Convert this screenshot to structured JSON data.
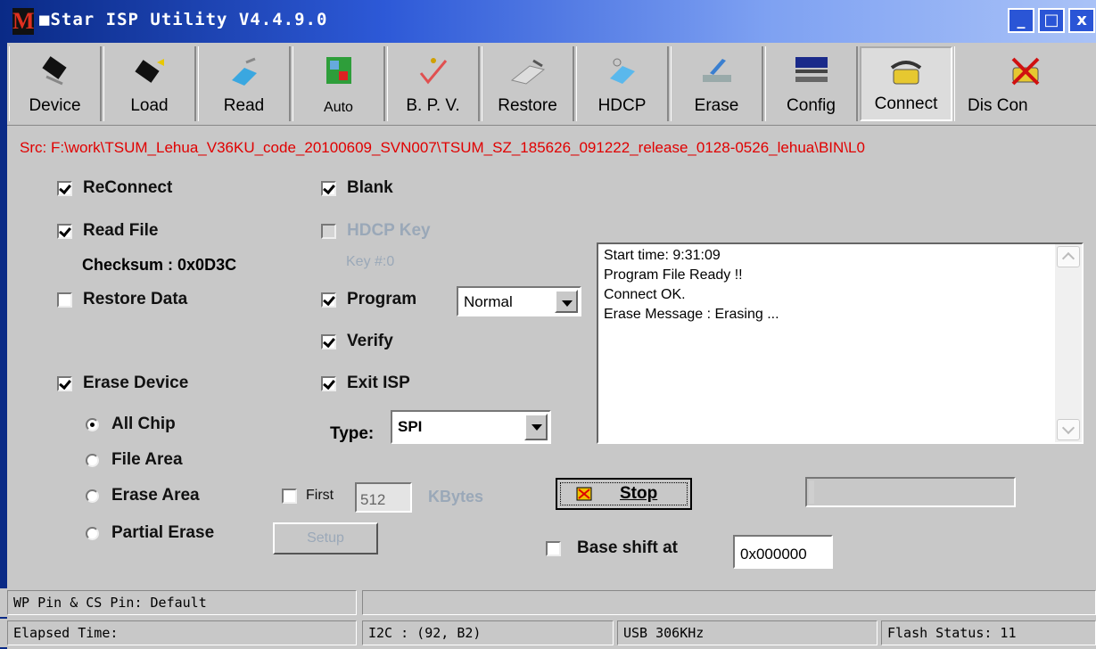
{
  "window": {
    "title": "■Star ISP Utility V4.4.9.0",
    "logo_letter": "M",
    "controls": {
      "minimize": "_",
      "maximize": "□",
      "close": "x"
    }
  },
  "toolbar": [
    {
      "label": "Device",
      "icon": "chip-icon"
    },
    {
      "label": "Load",
      "icon": "chip-load-icon"
    },
    {
      "label": "Read",
      "icon": "read-icon"
    },
    {
      "label": "Auto",
      "icon": "auto-icon"
    },
    {
      "label": "B. P. V.",
      "icon": "check-icon"
    },
    {
      "label": "Restore",
      "icon": "restore-icon"
    },
    {
      "label": "HDCP",
      "icon": "hdcp-icon"
    },
    {
      "label": "Erase",
      "icon": "erase-icon"
    },
    {
      "label": "Config",
      "icon": "config-icon"
    },
    {
      "label": "Connect",
      "icon": "phone-icon"
    },
    {
      "label": "Dis Con",
      "icon": "disconnect-icon"
    }
  ],
  "src_path": "Src: F:\\work\\TSUM_Lehua_V36KU_code_20100609_SVN007\\TSUM_SZ_185626_091222_release_0128-0526_lehua\\BIN\\L0",
  "options": {
    "reconnect": "ReConnect",
    "read_file": "Read File",
    "checksum": "Checksum : 0x0D3C",
    "restore_data": "Restore Data",
    "erase_device": "Erase Device",
    "all_chip": "All Chip",
    "file_area": "File Area",
    "erase_area": "Erase Area",
    "partial_erase": "Partial Erase",
    "blank": "Blank",
    "hdcp_key": "HDCP Key",
    "key_num": "Key #:0",
    "program": "Program",
    "program_mode": "Normal",
    "verify": "Verify",
    "exit_isp": "Exit ISP",
    "type_label": "Type:",
    "type_value": "SPI",
    "first": "First",
    "first_value": "512",
    "kbytes": "KBytes",
    "setup": "Setup",
    "base_shift": "Base shift at",
    "base_shift_value": "0x000000"
  },
  "log": [
    "Start time: 9:31:09",
    "Program File Ready !!",
    "Connect OK.",
    "Erase Message : Erasing ..."
  ],
  "stop_label": "Stop",
  "status": {
    "wp_pin": "WP Pin & CS Pin: Default",
    "elapsed": "Elapsed Time:",
    "i2c": "I2C :  (92,  B2)",
    "usb": "USB  306KHz",
    "flash": "Flash Status: 11"
  },
  "colors": {
    "title_start": "#0a2a86",
    "title_end": "#a9c2f7",
    "src_text": "#e00000",
    "disabled_text": "#9aa8b8"
  }
}
